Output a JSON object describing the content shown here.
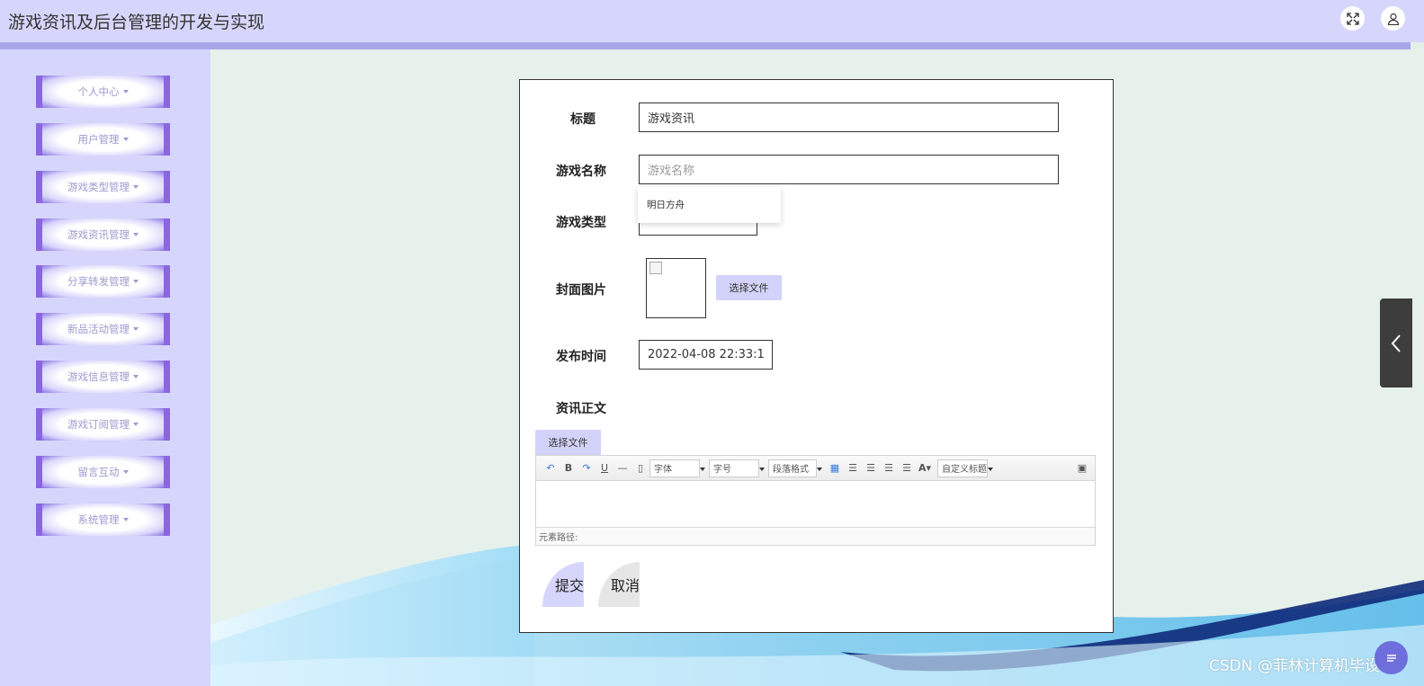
{
  "header": {
    "title": "游戏资讯及后台管理的开发与实现"
  },
  "sidebar": {
    "items": [
      {
        "label": "个人中心"
      },
      {
        "label": "用户管理"
      },
      {
        "label": "游戏类型管理"
      },
      {
        "label": "游戏资讯管理"
      },
      {
        "label": "分享转发管理"
      },
      {
        "label": "新品活动管理"
      },
      {
        "label": "游戏信息管理"
      },
      {
        "label": "游戏订阅管理"
      },
      {
        "label": "留言互动"
      },
      {
        "label": "系统管理"
      }
    ]
  },
  "form": {
    "title_label": "标题",
    "title_value": "游戏资讯",
    "game_name_label": "游戏名称",
    "game_name_placeholder": "游戏名称",
    "game_name_suggestion": "明日方舟",
    "game_type_label": "游戏类型",
    "cover_label": "封面图片",
    "choose_file_label": "选择文件",
    "publish_time_label": "发布时间",
    "publish_time_value": "2022-04-08 22:33:1",
    "content_label": "资讯正文",
    "editor_choose_file_label": "选择文件",
    "editor": {
      "font_select": "字体",
      "size_select": "字号",
      "paragraph_select": "段落格式",
      "custom_title_select": "自定义标题",
      "element_path": "元素路径:"
    },
    "submit_label": "提交",
    "cancel_label": "取消"
  },
  "watermark": "CSDN @菲林计算机毕设",
  "colors": {
    "accent": "#d6d6fc",
    "menu_border": "#8a67e0",
    "background": "#e7f1eb"
  }
}
